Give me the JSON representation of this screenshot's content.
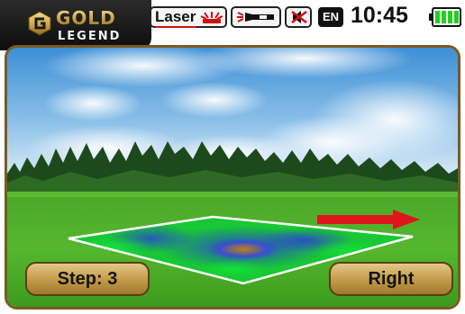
{
  "brand": {
    "name_top": "GOLD",
    "name_bottom": "LEGEND"
  },
  "status_bar": {
    "laser_label": "Laser",
    "language": "EN",
    "time": "10:45",
    "battery_level": 1.0
  },
  "icons": {
    "laser": "laser-icon",
    "flashlight": "flashlight-icon",
    "sound": "sound-muted-icon",
    "battery": "battery-icon",
    "logo": "gold-legend-logo-icon",
    "direction": "arrow-right-icon"
  },
  "scan": {
    "step_label": "Step: 3",
    "direction_label": "Right"
  },
  "colors": {
    "accent_gold": "#c9a14f",
    "frame_brown": "#7a5a22",
    "laser_red": "#d01010",
    "battery_green": "#1fd11f",
    "arrow_red": "#e0141a"
  }
}
